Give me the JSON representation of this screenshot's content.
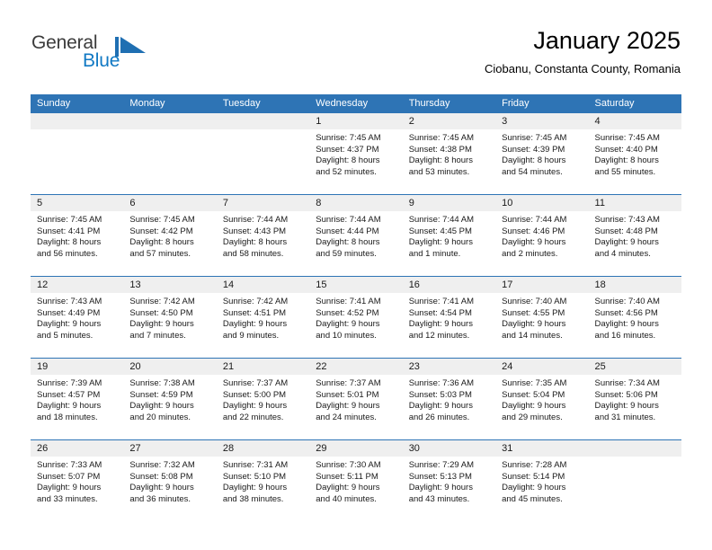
{
  "brand": {
    "name_part1": "General",
    "name_part2": "Blue",
    "logo_icon": "triangle-flag-icon",
    "accent_color": "#1179c4"
  },
  "header": {
    "title": "January 2025",
    "subtitle": "Ciobanu, Constanta County, Romania"
  },
  "calendar": {
    "header_color": "#2e74b5",
    "daynum_band_color": "#efefef",
    "weekday_headers": [
      "Sunday",
      "Monday",
      "Tuesday",
      "Wednesday",
      "Thursday",
      "Friday",
      "Saturday"
    ],
    "weeks": [
      [
        {
          "day": "",
          "lines": []
        },
        {
          "day": "",
          "lines": []
        },
        {
          "day": "",
          "lines": []
        },
        {
          "day": "1",
          "lines": [
            "Sunrise: 7:45 AM",
            "Sunset: 4:37 PM",
            "Daylight: 8 hours",
            "and 52 minutes."
          ]
        },
        {
          "day": "2",
          "lines": [
            "Sunrise: 7:45 AM",
            "Sunset: 4:38 PM",
            "Daylight: 8 hours",
            "and 53 minutes."
          ]
        },
        {
          "day": "3",
          "lines": [
            "Sunrise: 7:45 AM",
            "Sunset: 4:39 PM",
            "Daylight: 8 hours",
            "and 54 minutes."
          ]
        },
        {
          "day": "4",
          "lines": [
            "Sunrise: 7:45 AM",
            "Sunset: 4:40 PM",
            "Daylight: 8 hours",
            "and 55 minutes."
          ]
        }
      ],
      [
        {
          "day": "5",
          "lines": [
            "Sunrise: 7:45 AM",
            "Sunset: 4:41 PM",
            "Daylight: 8 hours",
            "and 56 minutes."
          ]
        },
        {
          "day": "6",
          "lines": [
            "Sunrise: 7:45 AM",
            "Sunset: 4:42 PM",
            "Daylight: 8 hours",
            "and 57 minutes."
          ]
        },
        {
          "day": "7",
          "lines": [
            "Sunrise: 7:44 AM",
            "Sunset: 4:43 PM",
            "Daylight: 8 hours",
            "and 58 minutes."
          ]
        },
        {
          "day": "8",
          "lines": [
            "Sunrise: 7:44 AM",
            "Sunset: 4:44 PM",
            "Daylight: 8 hours",
            "and 59 minutes."
          ]
        },
        {
          "day": "9",
          "lines": [
            "Sunrise: 7:44 AM",
            "Sunset: 4:45 PM",
            "Daylight: 9 hours",
            "and 1 minute."
          ]
        },
        {
          "day": "10",
          "lines": [
            "Sunrise: 7:44 AM",
            "Sunset: 4:46 PM",
            "Daylight: 9 hours",
            "and 2 minutes."
          ]
        },
        {
          "day": "11",
          "lines": [
            "Sunrise: 7:43 AM",
            "Sunset: 4:48 PM",
            "Daylight: 9 hours",
            "and 4 minutes."
          ]
        }
      ],
      [
        {
          "day": "12",
          "lines": [
            "Sunrise: 7:43 AM",
            "Sunset: 4:49 PM",
            "Daylight: 9 hours",
            "and 5 minutes."
          ]
        },
        {
          "day": "13",
          "lines": [
            "Sunrise: 7:42 AM",
            "Sunset: 4:50 PM",
            "Daylight: 9 hours",
            "and 7 minutes."
          ]
        },
        {
          "day": "14",
          "lines": [
            "Sunrise: 7:42 AM",
            "Sunset: 4:51 PM",
            "Daylight: 9 hours",
            "and 9 minutes."
          ]
        },
        {
          "day": "15",
          "lines": [
            "Sunrise: 7:41 AM",
            "Sunset: 4:52 PM",
            "Daylight: 9 hours",
            "and 10 minutes."
          ]
        },
        {
          "day": "16",
          "lines": [
            "Sunrise: 7:41 AM",
            "Sunset: 4:54 PM",
            "Daylight: 9 hours",
            "and 12 minutes."
          ]
        },
        {
          "day": "17",
          "lines": [
            "Sunrise: 7:40 AM",
            "Sunset: 4:55 PM",
            "Daylight: 9 hours",
            "and 14 minutes."
          ]
        },
        {
          "day": "18",
          "lines": [
            "Sunrise: 7:40 AM",
            "Sunset: 4:56 PM",
            "Daylight: 9 hours",
            "and 16 minutes."
          ]
        }
      ],
      [
        {
          "day": "19",
          "lines": [
            "Sunrise: 7:39 AM",
            "Sunset: 4:57 PM",
            "Daylight: 9 hours",
            "and 18 minutes."
          ]
        },
        {
          "day": "20",
          "lines": [
            "Sunrise: 7:38 AM",
            "Sunset: 4:59 PM",
            "Daylight: 9 hours",
            "and 20 minutes."
          ]
        },
        {
          "day": "21",
          "lines": [
            "Sunrise: 7:37 AM",
            "Sunset: 5:00 PM",
            "Daylight: 9 hours",
            "and 22 minutes."
          ]
        },
        {
          "day": "22",
          "lines": [
            "Sunrise: 7:37 AM",
            "Sunset: 5:01 PM",
            "Daylight: 9 hours",
            "and 24 minutes."
          ]
        },
        {
          "day": "23",
          "lines": [
            "Sunrise: 7:36 AM",
            "Sunset: 5:03 PM",
            "Daylight: 9 hours",
            "and 26 minutes."
          ]
        },
        {
          "day": "24",
          "lines": [
            "Sunrise: 7:35 AM",
            "Sunset: 5:04 PM",
            "Daylight: 9 hours",
            "and 29 minutes."
          ]
        },
        {
          "day": "25",
          "lines": [
            "Sunrise: 7:34 AM",
            "Sunset: 5:06 PM",
            "Daylight: 9 hours",
            "and 31 minutes."
          ]
        }
      ],
      [
        {
          "day": "26",
          "lines": [
            "Sunrise: 7:33 AM",
            "Sunset: 5:07 PM",
            "Daylight: 9 hours",
            "and 33 minutes."
          ]
        },
        {
          "day": "27",
          "lines": [
            "Sunrise: 7:32 AM",
            "Sunset: 5:08 PM",
            "Daylight: 9 hours",
            "and 36 minutes."
          ]
        },
        {
          "day": "28",
          "lines": [
            "Sunrise: 7:31 AM",
            "Sunset: 5:10 PM",
            "Daylight: 9 hours",
            "and 38 minutes."
          ]
        },
        {
          "day": "29",
          "lines": [
            "Sunrise: 7:30 AM",
            "Sunset: 5:11 PM",
            "Daylight: 9 hours",
            "and 40 minutes."
          ]
        },
        {
          "day": "30",
          "lines": [
            "Sunrise: 7:29 AM",
            "Sunset: 5:13 PM",
            "Daylight: 9 hours",
            "and 43 minutes."
          ]
        },
        {
          "day": "31",
          "lines": [
            "Sunrise: 7:28 AM",
            "Sunset: 5:14 PM",
            "Daylight: 9 hours",
            "and 45 minutes."
          ]
        },
        {
          "day": "",
          "lines": []
        }
      ]
    ]
  }
}
